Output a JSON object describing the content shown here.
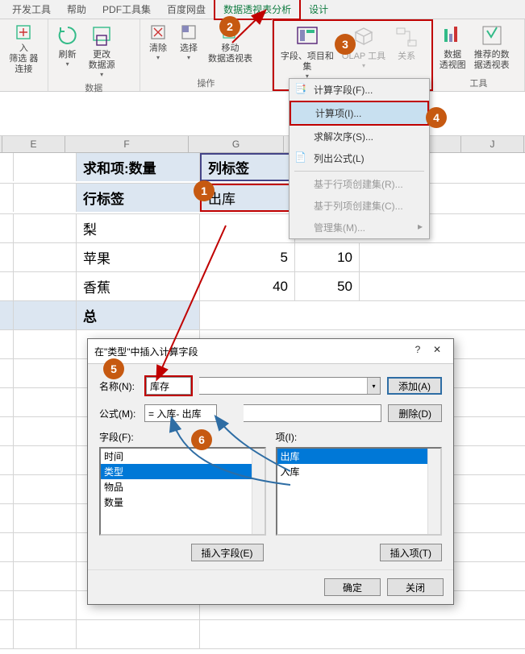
{
  "tabs": {
    "dev": "开发工具",
    "help": "帮助",
    "pdf": "PDF工具集",
    "baidu": "百度网盘",
    "analyze": "数据透视表分析",
    "design": "设计"
  },
  "ribbon": {
    "group_data_label": "数据",
    "group_op_label": "操作",
    "group_tools_label": "工具",
    "refresh": "刷新",
    "change_ds": "更改\n数据源",
    "clear": "清除",
    "select": "选择",
    "move": "移动\n数据透视表",
    "fields": "字段、项目和\n集",
    "olap": "OLAP 工具",
    "relation": "关系",
    "pivotchart": "数据\n透视图",
    "recommend": "推荐的数\n据透视表",
    "insert_label": "入",
    "filter_label": "筛选\n器连接"
  },
  "menu": {
    "calc_field": "计算字段(F)...",
    "calc_item": "计算项(I)...",
    "solve_order": "求解次序(S)...",
    "list_formulas": "列出公式(L)",
    "create_row_set": "基于行项创建集(R)...",
    "create_col_set": "基于列项创建集(C)...",
    "manage_sets": "管理集(M)..."
  },
  "circles": {
    "c1": "1",
    "c2": "2",
    "c3": "3",
    "c4": "4",
    "c5": "5",
    "c6": "6"
  },
  "cols": {
    "E": "E",
    "F": "F",
    "G": "G",
    "J": "J"
  },
  "sheet": {
    "sum_label": "求和项:数量",
    "col_labels": "列标签",
    "row_labels": "行标签",
    "chuku": "出库",
    "r1_item": "梨",
    "r2_item": "苹果",
    "r2_v1": "5",
    "r2_v2": "10",
    "r3_item": "香蕉",
    "r3_v1": "40",
    "r3_v2": "50",
    "total": "总"
  },
  "dialog": {
    "title": "在\"类型\"中插入计算字段",
    "name_label": "名称(N):",
    "name_value": "库存",
    "formula_label": "公式(M):",
    "formula_value": "= 入库- 出库",
    "add_btn": "添加(A)",
    "delete_btn": "删除(D)",
    "fields_label": "字段(F):",
    "items_label": "项(I):",
    "field_list": [
      "时间",
      "类型",
      "物品",
      "数量"
    ],
    "field_selected": "类型",
    "item_list": [
      "出库",
      "入库"
    ],
    "item_selected": "出库",
    "insert_field_btn": "插入字段(E)",
    "insert_item_btn": "插入项(T)",
    "ok_btn": "确定",
    "close_btn": "关闭"
  },
  "chart_data": {
    "type": "table",
    "columns": [
      "物品",
      "出库",
      "入库"
    ],
    "rows": [
      {
        "物品": "梨"
      },
      {
        "物品": "苹果",
        "出库": 5,
        "入库": 10
      },
      {
        "物品": "香蕉",
        "出库": 40,
        "入库": 50
      }
    ]
  }
}
